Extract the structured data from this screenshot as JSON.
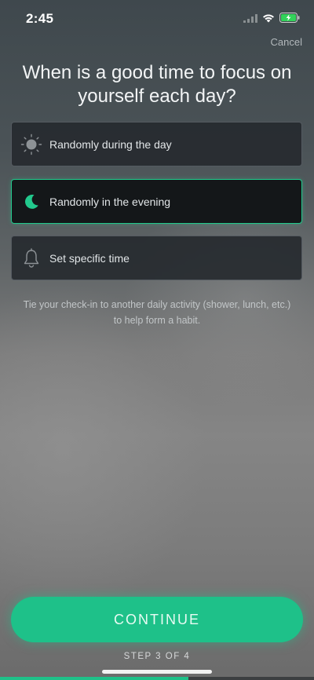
{
  "status_bar": {
    "time": "2:45",
    "icons": [
      "signal-icon",
      "wifi-icon",
      "battery-charging-icon"
    ]
  },
  "header": {
    "cancel_label": "Cancel"
  },
  "question": {
    "title": "When is a good time to focus on yourself each day?"
  },
  "options": [
    {
      "label": "Randomly during the day",
      "icon": "sun-icon",
      "selected": false
    },
    {
      "label": "Randomly in the evening",
      "icon": "moon-icon",
      "selected": true
    },
    {
      "label": "Set specific time",
      "icon": "bell-icon",
      "selected": false
    }
  ],
  "hint_text": "Tie your check-in to another daily activity (shower, lunch, etc.) to help form a habit.",
  "footer": {
    "continue_label": "CONTINUE",
    "step_label": "STEP 3 OF 4",
    "progress_fraction": 0.6
  },
  "colors": {
    "accent": "#1ec189",
    "option_bg": "#262a2f",
    "selected_bg": "#141719"
  }
}
